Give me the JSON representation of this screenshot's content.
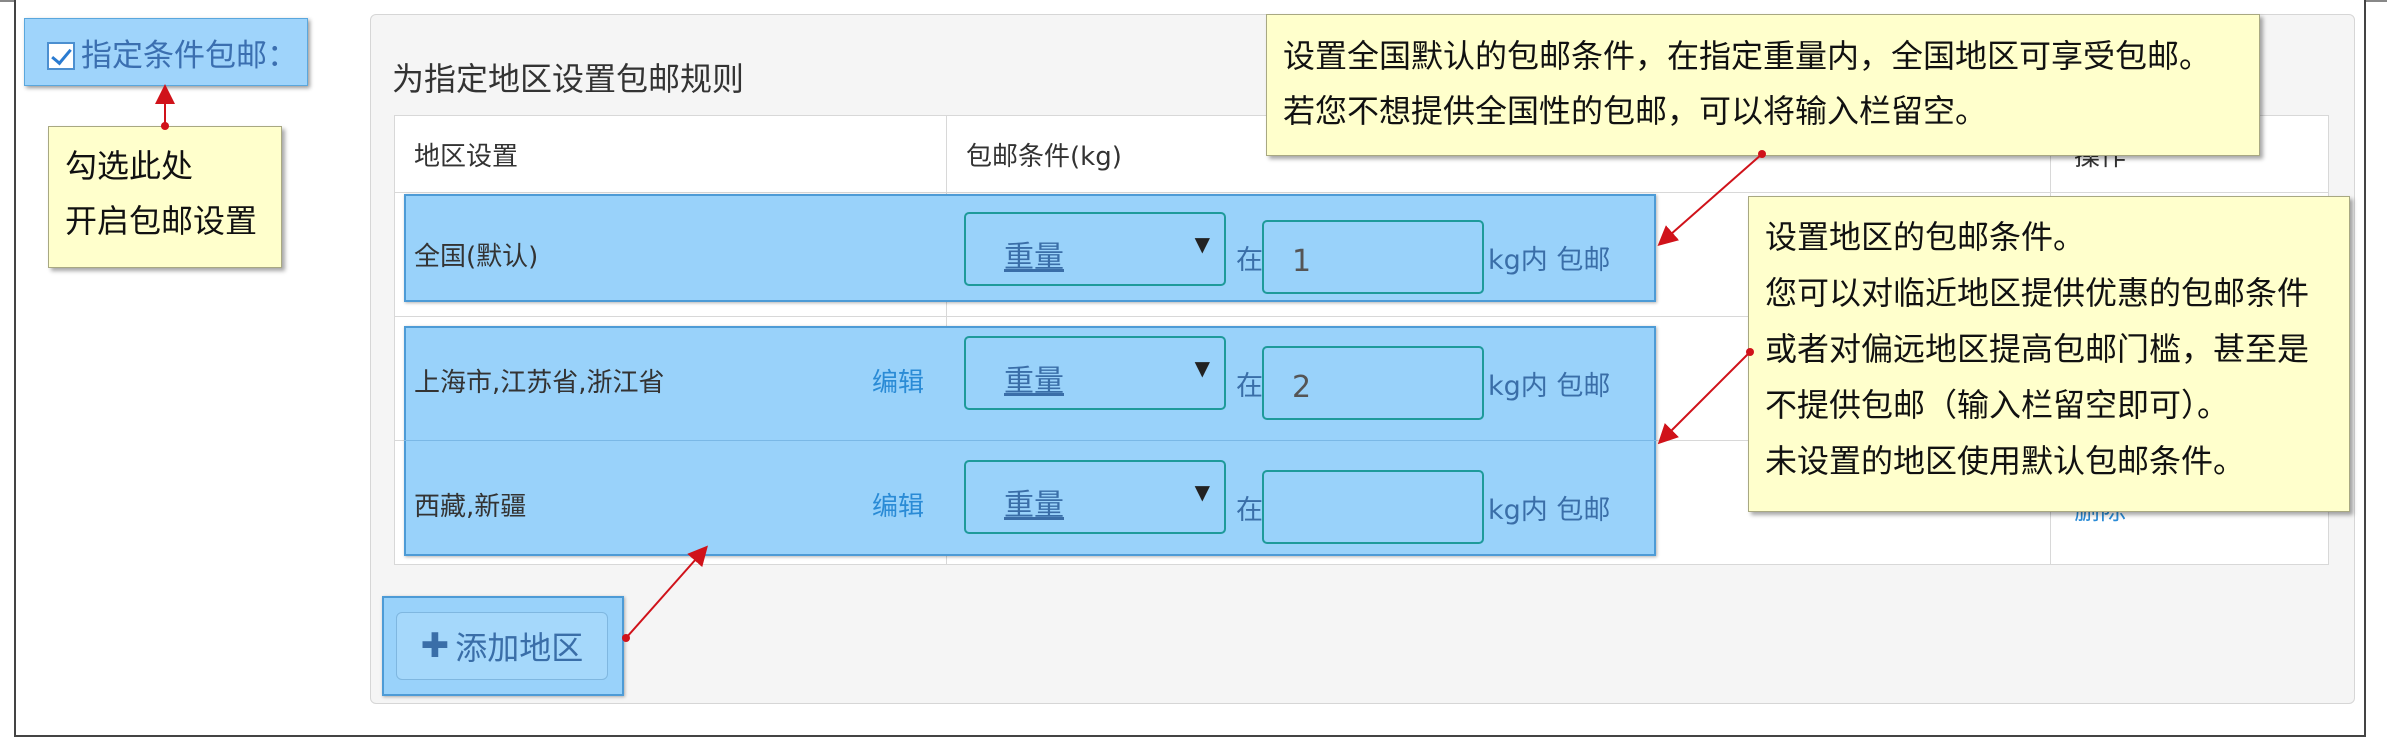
{
  "checkbox": {
    "label": "指定条件包邮：",
    "checked": true
  },
  "callout_checkbox": {
    "lines": [
      "勾选此处",
      "开启包邮设置"
    ]
  },
  "panel": {
    "title": "为指定地区设置包邮规则"
  },
  "table": {
    "headers": {
      "region": "地区设置",
      "condition": "包邮条件(kg)",
      "ops": "操作"
    },
    "rows": [
      {
        "region": "全国(默认)",
        "edit": "",
        "condition_type": "重量",
        "prefix": "在",
        "value": "1",
        "suffix": "kg内 包邮"
      },
      {
        "region": "上海市,江苏省,浙江省",
        "edit": "编辑",
        "condition_type": "重量",
        "prefix": "在",
        "value": "2",
        "suffix": "kg内 包邮"
      },
      {
        "region": "西藏,新疆",
        "edit": "编辑",
        "condition_type": "重量",
        "prefix": "在",
        "value": "",
        "suffix": "kg内 包邮"
      }
    ],
    "ops_partial": "删除"
  },
  "add_button": {
    "label": "添加地区",
    "icon": "plus-icon"
  },
  "callout_default": {
    "lines": [
      "设置全国默认的包邮条件，在指定重量内，全国地区可享受包邮。",
      "若您不想提供全国性的包邮，可以将输入栏留空。"
    ]
  },
  "callout_region": {
    "lines": [
      "设置地区的包邮条件。",
      "您可以对临近地区提供优惠的包邮条件",
      "或者对偏远地区提高包邮门槛，甚至是",
      "不提供包邮（输入栏留空即可）。",
      "未设置的地区使用默认包邮条件。"
    ]
  },
  "colors": {
    "highlight": "#99d2fa",
    "note_bg": "#ffffcc",
    "arrow": "#d0121a",
    "link": "#2a8bd6"
  }
}
